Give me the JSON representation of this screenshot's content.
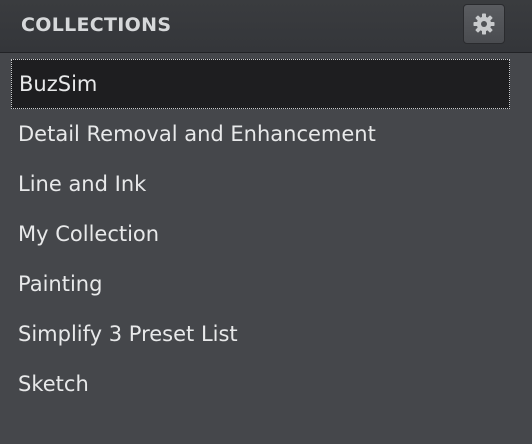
{
  "header": {
    "title": "COLLECTIONS",
    "settings_icon": "gear-icon"
  },
  "collections": {
    "selected_index": 0,
    "items": [
      {
        "label": "BuzSim"
      },
      {
        "label": "Detail Removal and Enhancement"
      },
      {
        "label": "Line and Ink"
      },
      {
        "label": "My Collection"
      },
      {
        "label": "Painting"
      },
      {
        "label": "Simplify 3 Preset List"
      },
      {
        "label": "Sketch"
      }
    ]
  },
  "colors": {
    "panel_bg": "#45474b",
    "selected_bg": "#1e1e20",
    "text": "#e8e9ea"
  }
}
